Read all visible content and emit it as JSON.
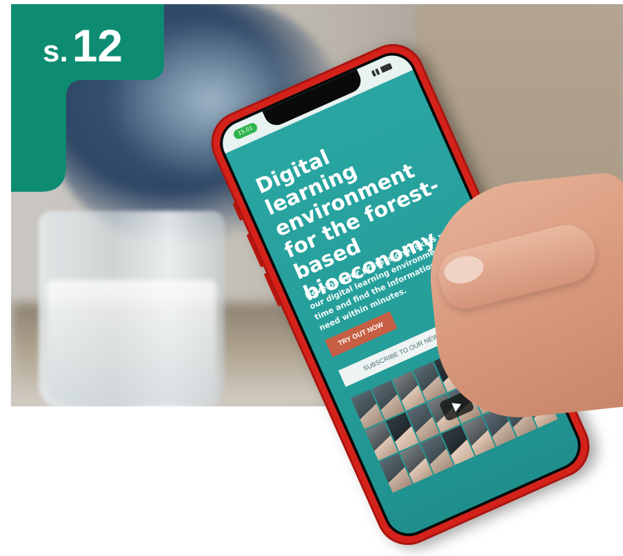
{
  "badge": {
    "prefix": "s.",
    "number": "12",
    "color": "#0e8c72"
  },
  "phone": {
    "status_time": "15.01",
    "hero": {
      "title": "Digital learning environment for the forest-based bioeconomy",
      "text": "Develop your professional skills with our digital learning environment. Save time and find the information you need within minutes.",
      "cta_label": "TRY OUT NOW",
      "newsletter_label": "SUBSCRIBE TO OUR NEWSLETTER"
    },
    "colors": {
      "screen_bg": "#2aa7a3",
      "cta_bg": "#c75f44",
      "phone_body": "#d4221b"
    },
    "video_icon": "play-icon"
  }
}
